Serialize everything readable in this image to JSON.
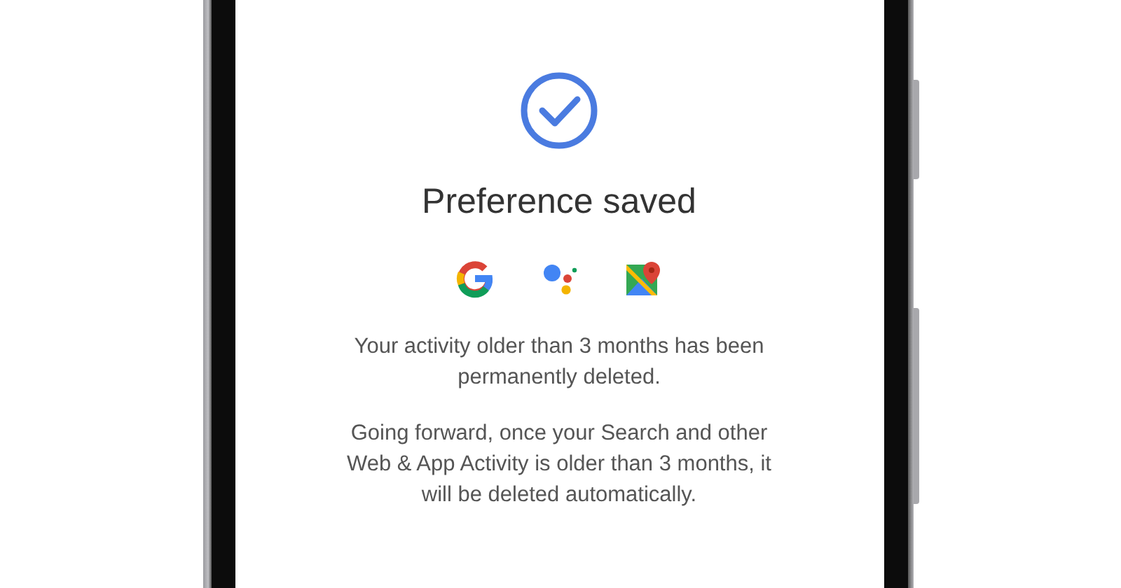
{
  "screen": {
    "title": "Preference saved",
    "paragraphs": [
      "Your activity older than 3 months has been permanently deleted.",
      "Going forward, once your Search and other Web & App Activity is older than 3 months, it will be deleted automatically."
    ]
  }
}
